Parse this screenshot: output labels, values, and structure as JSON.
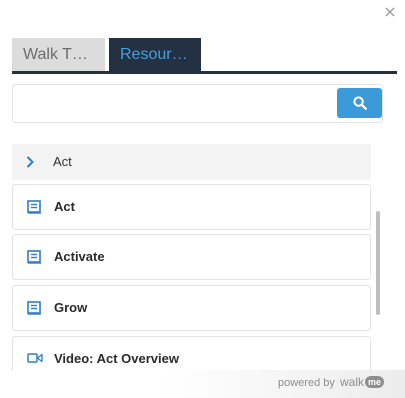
{
  "window": {
    "close_label": "×"
  },
  "tabs": [
    {
      "label": "Walk T…",
      "active": false
    },
    {
      "label": "Resour…",
      "active": true
    }
  ],
  "search": {
    "value": "",
    "placeholder": "",
    "icon": "search-icon"
  },
  "folder": {
    "label": "Act",
    "icon": "chevron-right-icon"
  },
  "items": [
    {
      "label": "Act",
      "icon": "article-icon"
    },
    {
      "label": "Activate",
      "icon": "article-icon"
    },
    {
      "label": "Grow",
      "icon": "article-icon"
    },
    {
      "label": "Video: Act Overview",
      "icon": "video-icon"
    }
  ],
  "footer": {
    "powered_by": "powered by",
    "brand_walk": "walk",
    "brand_me": "me"
  },
  "colors": {
    "accent": "#3d9ad9",
    "tab_active_bg": "#233142",
    "tab_active_text": "#43a0dd",
    "tab_inactive_bg": "#dcdcdc"
  }
}
